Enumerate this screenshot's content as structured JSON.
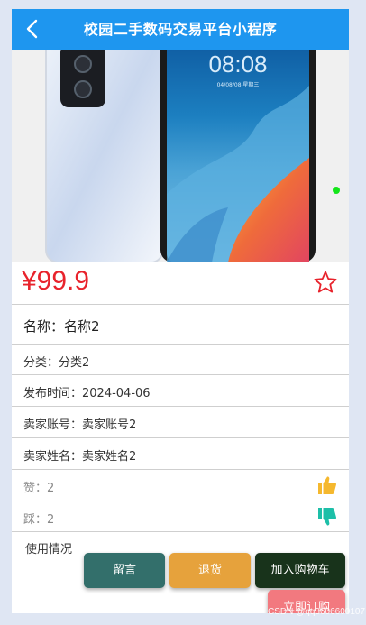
{
  "header": {
    "title": "校园二手数码交易平台小程序",
    "back_icon": "chevron-left-icon",
    "background": "#1e96ef"
  },
  "gallery": {
    "phone_clock": "08:08",
    "phone_date": "04/08/08 星期三",
    "indicator_color": "#14e51a"
  },
  "product": {
    "price": "¥99.9",
    "favorite_icon": "star-outline-icon",
    "name": "名称：名称2",
    "category": "分类：分类2",
    "publish_time": "发布时间：2024-04-06",
    "seller_account": "卖家账号：卖家账号2",
    "seller_name": "卖家姓名：卖家姓名2",
    "likes": "赞：2",
    "dislikes": "踩：2",
    "usage_label": "使用情况"
  },
  "actions": {
    "message": "留言",
    "return": "退货",
    "add_to_cart": "加入购物车",
    "buy_now": "立即订购"
  },
  "colors": {
    "price": "#e8232c",
    "like_icon": "#f5b82e",
    "dislike_icon": "#1dbfa8",
    "btn_message": "#336f6b",
    "btn_return": "#e6a23c",
    "btn_cart": "#18331b",
    "btn_buy": "#f2797f"
  },
  "watermark": "CSDN @qq3606600107"
}
